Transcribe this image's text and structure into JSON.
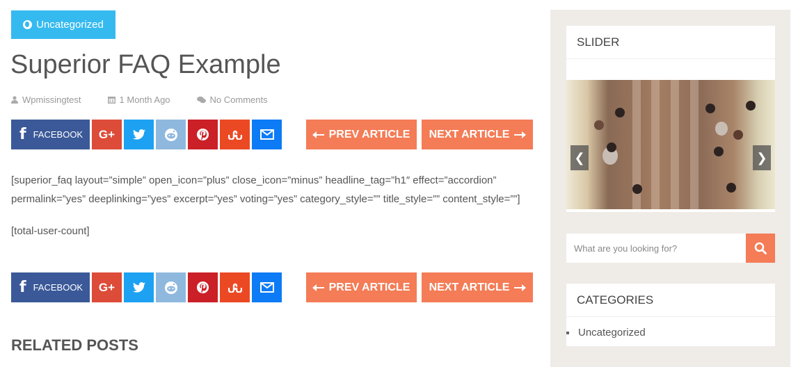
{
  "post": {
    "category": "Uncategorized",
    "title": "Superior FAQ Example",
    "meta": {
      "author": "Wpmissingtest",
      "date": "1 Month Ago",
      "comments": "No Comments"
    },
    "share": {
      "facebook_label": "FACEBOOK",
      "google_plus_label": "G+"
    },
    "nav": {
      "prev_label": "PREV ARTICLE",
      "next_label": "NEXT ARTICLE"
    },
    "content": [
      "[superior_faq layout=”simple” open_icon=”plus” close_icon=”minus” headline_tag=”h1″ effect=”accordion” permalink=”yes” deeplinking=”yes” excerpt=”yes” voting=”yes” category_style=”” title_style=”” content_style=””]",
      "[total-user-count]"
    ],
    "related_heading": "RELATED POSTS"
  },
  "sidebar": {
    "slider_title": "SLIDER",
    "slider_prev": "❮",
    "slider_next": "❯",
    "search_placeholder": "What are you looking for?",
    "categories_title": "CATEGORIES",
    "categories": [
      "Uncategorized"
    ]
  },
  "colors": {
    "badge": "#35baf0",
    "accent": "#f47c56",
    "facebook": "#3b5998",
    "google_plus": "#dd4b39",
    "twitter": "#1da1f2",
    "reddit": "#8fb8de",
    "pinterest": "#cb2027",
    "stumbleupon": "#eb4924",
    "email": "#0d7bf5",
    "sidebar_bg": "#efebe7"
  }
}
